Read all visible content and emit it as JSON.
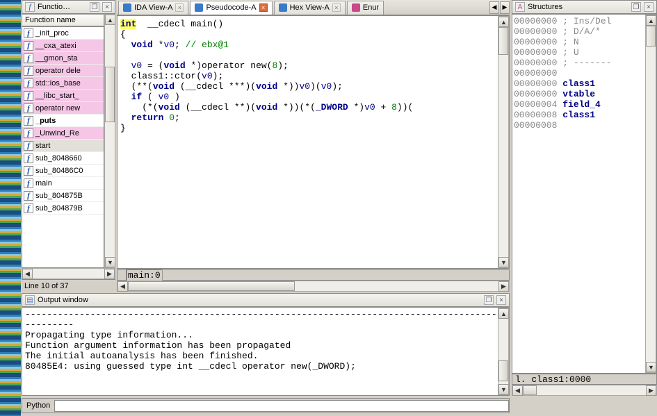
{
  "panels": {
    "functions": {
      "title": "Functio…",
      "col_header": "Function name",
      "status": "Line 10 of 37"
    },
    "structures": {
      "title": "Structures",
      "status": "l.  class1:0000"
    },
    "output": {
      "title": "Output window"
    },
    "python": {
      "label": "Python",
      "value": ""
    }
  },
  "tabs": [
    {
      "label": "IDA View-A",
      "icon_color": "#3a7ac8",
      "active": false
    },
    {
      "label": "Pseudocode-A",
      "icon_color": "#3a7ac8",
      "active": true
    },
    {
      "label": "Hex View-A",
      "icon_color": "#3a7ac8",
      "active": false
    },
    {
      "label": "Enur",
      "icon_color": "#c84a8a",
      "active": false,
      "truncated": true
    }
  ],
  "functions": [
    {
      "name": "_init_proc",
      "pink": false
    },
    {
      "name": "__cxa_atexi",
      "pink": true
    },
    {
      "name": "__gmon_sta",
      "pink": true
    },
    {
      "name": "operator dele",
      "pink": true
    },
    {
      "name": "std::ios_base",
      "pink": true
    },
    {
      "name": "__libc_start_",
      "pink": true
    },
    {
      "name": "operator new",
      "pink": true
    },
    {
      "name": "_puts",
      "pink": false,
      "bold": true
    },
    {
      "name": "_Unwind_Re",
      "pink": true
    },
    {
      "name": "start",
      "pink": false,
      "selected": true
    },
    {
      "name": "sub_8048660",
      "pink": false
    },
    {
      "name": "sub_80486C0",
      "pink": false
    },
    {
      "name": "main",
      "pink": false
    },
    {
      "name": "sub_804875B",
      "pink": false
    },
    {
      "name": "sub_804879B",
      "pink": false
    }
  ],
  "code": {
    "status": "main:0",
    "tokens": [
      [
        {
          "t": "int",
          "c": "kw",
          "hl": true
        },
        {
          "t": "  __cdecl main()",
          "c": ""
        }
      ],
      [
        {
          "t": "{",
          "c": ""
        }
      ],
      [
        {
          "t": "  ",
          "c": ""
        },
        {
          "t": "void",
          "c": "kw"
        },
        {
          "t": " *",
          "c": ""
        },
        {
          "t": "v0",
          "c": "nv"
        },
        {
          "t": "; ",
          "c": ""
        },
        {
          "t": "// ebx@1",
          "c": "gr"
        }
      ],
      [],
      [
        {
          "t": "  ",
          "c": ""
        },
        {
          "t": "v0",
          "c": "nv"
        },
        {
          "t": " = (",
          "c": ""
        },
        {
          "t": "void",
          "c": "kw"
        },
        {
          "t": " *)operator new(",
          "c": ""
        },
        {
          "t": "8",
          "c": "gr"
        },
        {
          "t": ");",
          "c": ""
        }
      ],
      [
        {
          "t": "  class1::ctor(",
          "c": ""
        },
        {
          "t": "v0",
          "c": "nv"
        },
        {
          "t": ");",
          "c": ""
        }
      ],
      [
        {
          "t": "  (**(",
          "c": ""
        },
        {
          "t": "void",
          "c": "kw"
        },
        {
          "t": " (__cdecl ***)(",
          "c": ""
        },
        {
          "t": "void",
          "c": "kw"
        },
        {
          "t": " *))",
          "c": ""
        },
        {
          "t": "v0",
          "c": "nv"
        },
        {
          "t": ")(",
          "c": ""
        },
        {
          "t": "v0",
          "c": "nv"
        },
        {
          "t": ");",
          "c": ""
        }
      ],
      [
        {
          "t": "  ",
          "c": ""
        },
        {
          "t": "if",
          "c": "kw"
        },
        {
          "t": " ( ",
          "c": ""
        },
        {
          "t": "v0",
          "c": "nv"
        },
        {
          "t": " )",
          "c": ""
        }
      ],
      [
        {
          "t": "    (*(",
          "c": ""
        },
        {
          "t": "void",
          "c": "kw"
        },
        {
          "t": " (__cdecl **)(",
          "c": ""
        },
        {
          "t": "void",
          "c": "kw"
        },
        {
          "t": " *))(*(",
          "c": ""
        },
        {
          "t": "_DWORD",
          "c": "kw"
        },
        {
          "t": " *)",
          "c": ""
        },
        {
          "t": "v0",
          "c": "nv"
        },
        {
          "t": " + ",
          "c": ""
        },
        {
          "t": "8",
          "c": "gr"
        },
        {
          "t": "))(",
          "c": ""
        }
      ],
      [
        {
          "t": "  ",
          "c": ""
        },
        {
          "t": "return",
          "c": "kw"
        },
        {
          "t": " ",
          "c": ""
        },
        {
          "t": "0",
          "c": "gr"
        },
        {
          "t": ";",
          "c": ""
        }
      ],
      [
        {
          "t": "}",
          "c": ""
        }
      ]
    ]
  },
  "structures": [
    {
      "addr": "00000000",
      "text": "; Ins/Del",
      "cls": "gray"
    },
    {
      "addr": "00000000",
      "text": "; D/A/*",
      "cls": "gray"
    },
    {
      "addr": "00000000",
      "text": "; N",
      "cls": "gray"
    },
    {
      "addr": "00000000",
      "text": "; U",
      "cls": "gray"
    },
    {
      "addr": "00000000",
      "text": "; -------",
      "cls": "gray"
    },
    {
      "addr": "00000000",
      "text": "",
      "cls": ""
    },
    {
      "addr": "00000000",
      "text": "class1",
      "cls": "blue"
    },
    {
      "addr": "00000000",
      "text": "vtable",
      "cls": "blue"
    },
    {
      "addr": "00000004",
      "text": "field_4",
      "cls": "blue"
    },
    {
      "addr": "00000008",
      "text": "class1",
      "cls": "blue"
    },
    {
      "addr": "00000008",
      "text": "",
      "cls": ""
    }
  ],
  "output_lines": [
    "---------------------------------------------------------------------------------------",
    "---------",
    "Propagating type information...",
    "Function argument information has been propagated",
    "The initial autoanalysis has been finished.",
    "80485E4: using guessed type int __cdecl operator new(_DWORD);"
  ]
}
